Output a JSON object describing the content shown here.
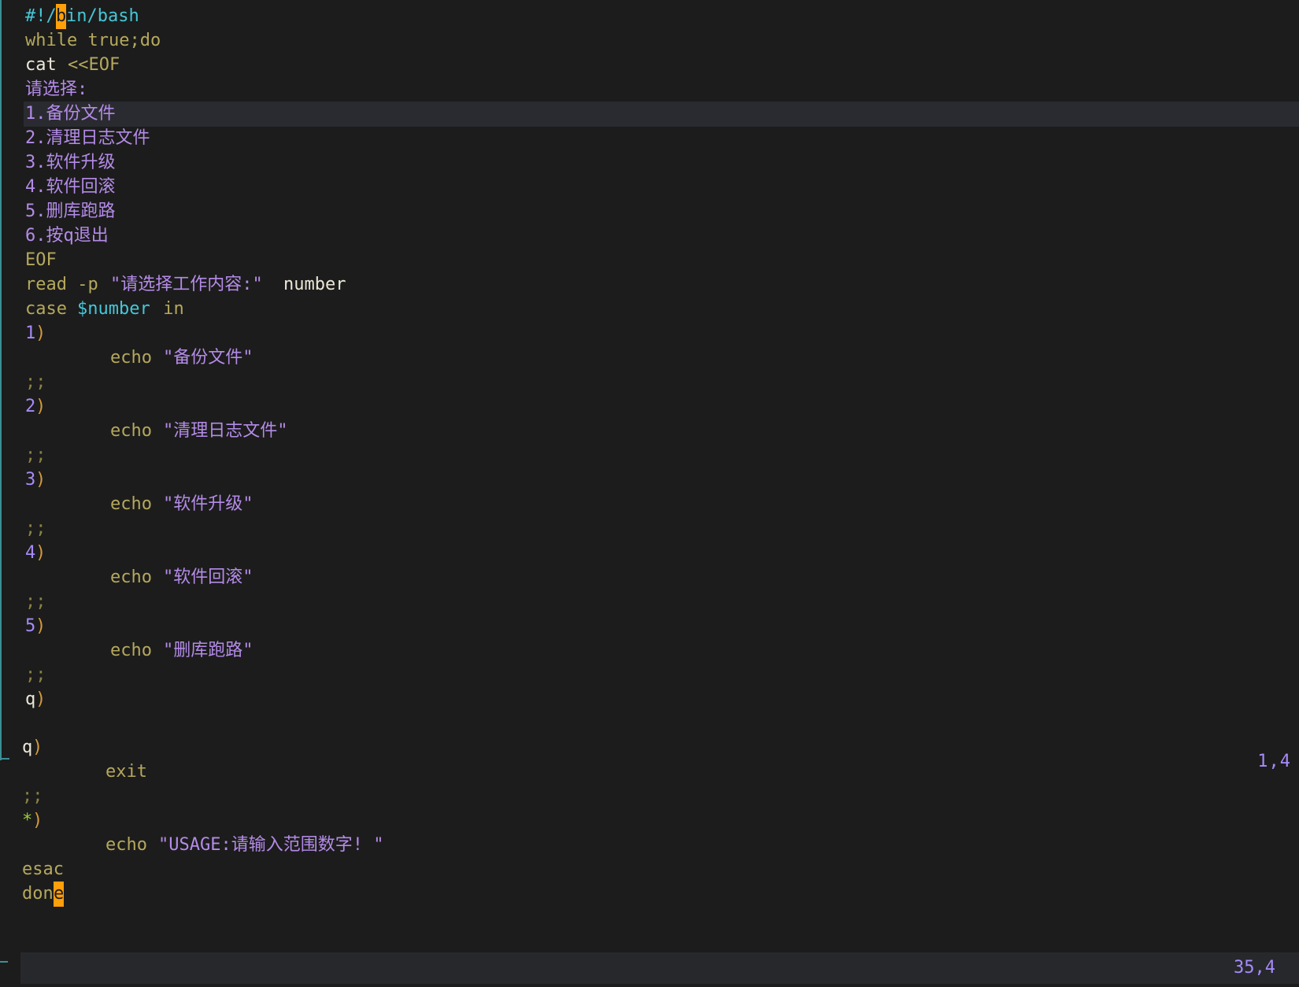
{
  "top": {
    "lines": [
      {
        "a": "#!/",
        "b": "b",
        "c": "in/bash"
      },
      {
        "kw": "while true;do"
      },
      {
        "p": "cat ",
        "d": "<<EOF"
      },
      {
        "s": "请选择:"
      },
      {
        "s": "1.备份文件"
      },
      {
        "s": "2.清理日志文件"
      },
      {
        "s": "3.软件升级"
      },
      {
        "s": "4.软件回滚"
      },
      {
        "s": "5.删库跑路"
      },
      {
        "s": "6.按q退出"
      },
      {
        "kw": "EOF"
      },
      {
        "kw": "read -p ",
        "s": "\"请选择工作内容:\" ",
        "p": "number"
      },
      {
        "kw": "case ",
        "cy": "$number",
        "kw2": " in"
      },
      {
        "n": "1",
        ")": ")"
      },
      {
        "indent": "echo ",
        "s": "\"备份文件\""
      },
      {
        "dim": ";;"
      },
      {
        "n": "2",
        ")": ")"
      },
      {
        "indent": "echo ",
        "s": "\"清理日志文件\""
      },
      {
        "dim": ";;"
      },
      {
        "n": "3",
        ")": ")"
      },
      {
        "indent": "echo ",
        "s": "\"软件升级\""
      },
      {
        "dim": ";;"
      },
      {
        "n": "4",
        ")": ")"
      },
      {
        "indent": "echo ",
        "s": "\"软件回滚\""
      },
      {
        "dim": ";;"
      },
      {
        "n": "5",
        ")": ")"
      },
      {
        "indent": "echo ",
        "s": "\"删库跑路\""
      },
      {
        "dim": ";;"
      },
      {
        "q": "q",
        ")": ")"
      }
    ],
    "ruler": "1,4"
  },
  "bottom": {
    "lines": [
      {
        "q": "q",
        ")": ")"
      },
      {
        "indent": "exit"
      },
      {
        "dim": ";;"
      },
      {
        "g": "*",
        ")": ")"
      },
      {
        "indent": "echo ",
        "s": "\"USAGE:请输入范围数字! \""
      },
      {
        "kw": "esac"
      },
      {
        "kw": "don",
        "cur": "e"
      }
    ],
    "ruler": "35,4"
  }
}
